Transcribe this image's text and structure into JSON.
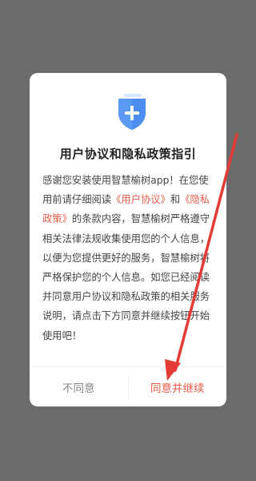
{
  "dialog": {
    "title": "用户协议和隐私政策指引",
    "body": {
      "p1": "感谢您安装使用智慧榆树app！在您使用前请仔细阅读",
      "link1": "《用户协议》",
      "and": "和",
      "link2": "《隐私政策》",
      "p2": "的条款内容，智慧榆树严格遵守相关法律法规收集使用您的个人信息，以便为您提供更好的服务，智慧榆树将严格保护您的个人信息。如您已经阅读并同意用户协议和隐私政策的相关服务说明，请点击下方同意并继续按钮开始使用吧！"
    },
    "buttons": {
      "disagree": "不同意",
      "agree": "同意并继续"
    }
  },
  "colors": {
    "accent": "#e85b4a",
    "shield": "#4b8ef0",
    "overlay": "#6b6b6b",
    "annotation_arrow": "#e53935"
  },
  "icons": {
    "shield": "shield-plus-icon"
  }
}
